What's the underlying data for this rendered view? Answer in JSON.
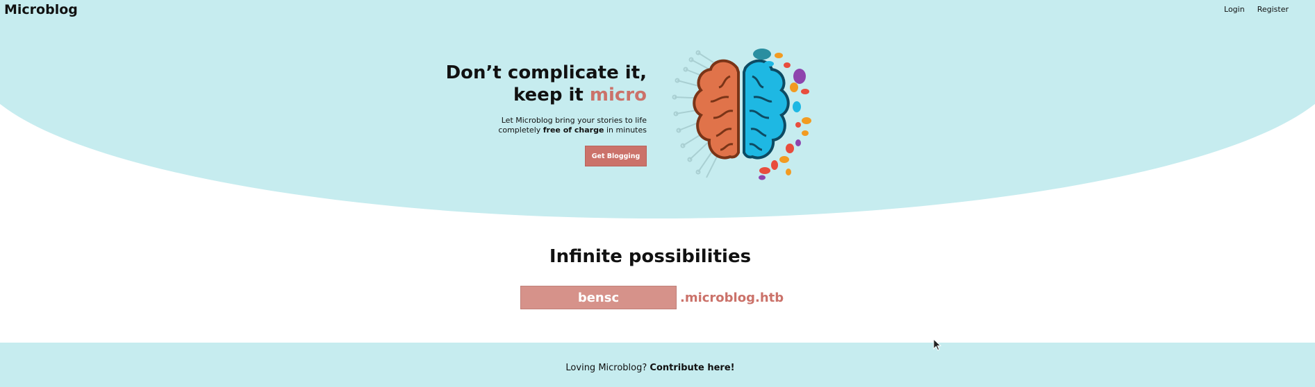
{
  "header": {
    "brand": "Microblog",
    "nav": {
      "login": "Login",
      "register": "Register"
    }
  },
  "hero": {
    "headline_line1": "Don’t complicate it,",
    "headline_line2_prefix": "keep it",
    "headline_accent": "micro",
    "sub_line1": "Let Microblog bring your stories to life",
    "sub_line2_prefix": "completely",
    "sub_line2_bold": "free of charge",
    "sub_line2_suffix": "in minutes",
    "cta_label": "Get Blogging"
  },
  "features": {
    "title": "Infinite possibilities",
    "subdomain_value": "bensc",
    "subdomain_suffix": ".microblog.htb"
  },
  "footer": {
    "text_prefix": "Loving Microblog?",
    "link": "Contribute here!"
  },
  "colors": {
    "hero_bg": "#c6ecef",
    "accent": "#cb726a",
    "input_bg": "#d6928a",
    "brain_left": "#e0734a",
    "brain_right": "#1eb8e3"
  }
}
